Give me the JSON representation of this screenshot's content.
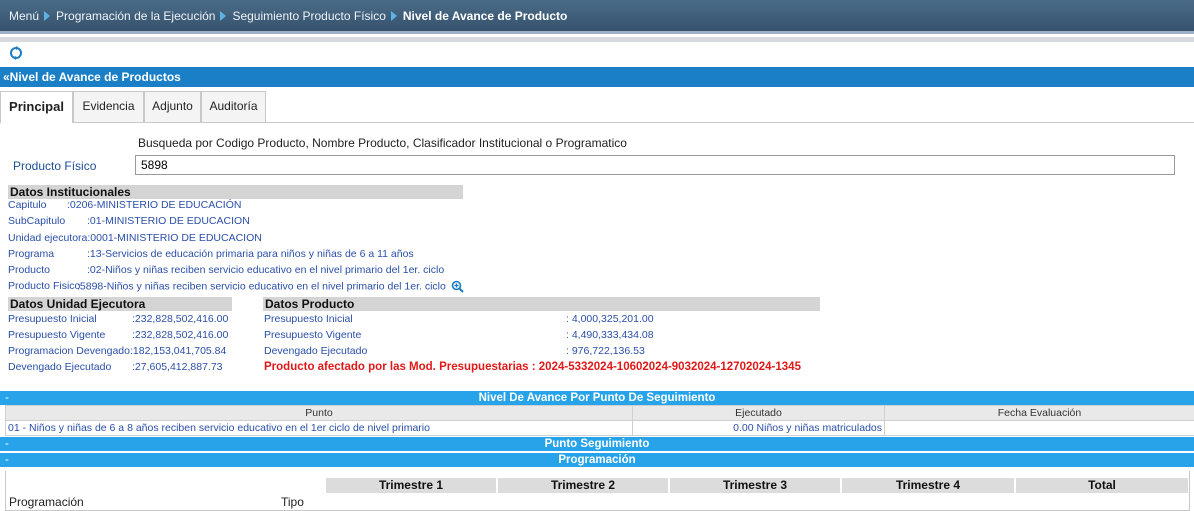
{
  "breadcrumb": {
    "items": [
      "Menú",
      "Programación de la Ejecución",
      "Seguimiento Producto Físico",
      "Nivel de Avance de Producto"
    ]
  },
  "section": {
    "title": "«Nivel de Avance de Productos"
  },
  "tabs": [
    {
      "label": "Principal",
      "active": true
    },
    {
      "label": "Evidencia",
      "active": false
    },
    {
      "label": "Adjunto",
      "active": false
    },
    {
      "label": "Auditoría",
      "active": false
    }
  ],
  "search": {
    "hint": "Busqueda por Codigo Producto, Nombre Producto, Clasificador Institucional o Programatico",
    "label": "Producto Físico",
    "value": "5898"
  },
  "institucionales": {
    "title": "Datos Institucionales",
    "rows": [
      {
        "label": "Capitulo",
        "value": ":0206-MINISTERIO DE EDUCACIÓN"
      },
      {
        "label": "SubCapitulo",
        "value": ":01-MINISTERIO DE EDUCACION"
      },
      {
        "label": "Unidad ejecutora",
        "value": ":0001-MINISTERIO DE EDUCACION"
      },
      {
        "label": "Programa",
        "value": ":13-Servicios de educación primaria para niños y niñas de 6 a 11 años"
      },
      {
        "label": "Producto",
        "value": ":02-Niños y niñas reciben servicio educativo en el nivel primario del 1er. ciclo"
      },
      {
        "label": "Producto Fisico",
        "value": ":5898-Niños y niñas reciben servicio educativo en el nivel primario del 1er. ciclo"
      }
    ]
  },
  "unidad_ejecutora": {
    "title": "Datos Unidad Ejecutora",
    "rows": [
      {
        "label": "Presupuesto Inicial",
        "value": ":232,828,502,416.00"
      },
      {
        "label": "Presupuesto Vigente",
        "value": ":232,828,502,416.00"
      },
      {
        "label": "Programacion Devengado",
        "value": ":182,153,041,705.84"
      },
      {
        "label": "Devengado Ejecutado",
        "value": ":27,605,412,887.73"
      }
    ]
  },
  "producto": {
    "title": "Datos Producto",
    "rows": [
      {
        "label": "Presupuesto Inicial",
        "value": ": 4,000,325,201.00"
      },
      {
        "label": "Presupuesto Vigente",
        "value": ": 4,490,333,434.08"
      },
      {
        "label": "Devengado Ejecutado",
        "value": ": 976,722,136.53"
      }
    ],
    "alert": "Producto afectado por las Mod. Presupuestarias : 2024-5332024-10602024-9032024-12702024-1345"
  },
  "nivel_avance": {
    "title": "Nivel De Avance Por Punto De Seguimiento",
    "dash": "-",
    "columns": [
      "Punto",
      "Ejecutado",
      "Fecha Evaluación"
    ],
    "rows": [
      {
        "punto": "01 - Niños y niñas de 6 a 8 años reciben servicio educativo en el 1er ciclo de nivel primario",
        "ejecutado": "0.00 Niños y niñas matriculados",
        "fecha": ""
      }
    ]
  },
  "punto_seguimiento": {
    "title": "Punto Seguimiento",
    "dash": "-"
  },
  "programacion": {
    "title": "Programación",
    "dash": "-",
    "row_label": "Programación",
    "tipo_label": "Tipo",
    "quarters": [
      "Trimestre 1",
      "Trimestre 2",
      "Trimestre 3",
      "Trimestre 4",
      "Total"
    ]
  }
}
